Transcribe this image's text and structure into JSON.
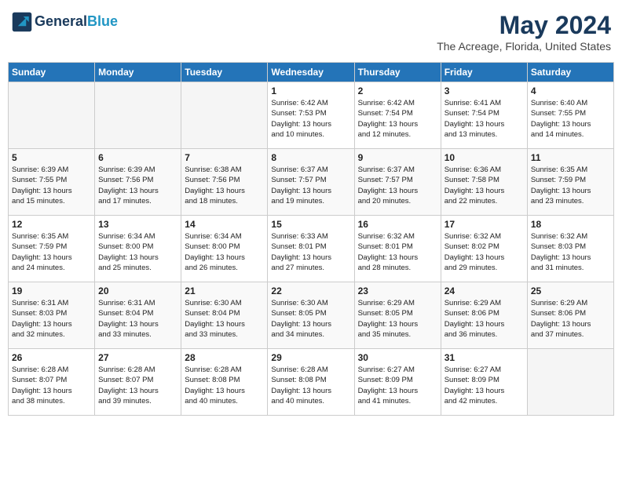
{
  "header": {
    "logo_line1": "General",
    "logo_line2": "Blue",
    "month_year": "May 2024",
    "location": "The Acreage, Florida, United States"
  },
  "weekdays": [
    "Sunday",
    "Monday",
    "Tuesday",
    "Wednesday",
    "Thursday",
    "Friday",
    "Saturday"
  ],
  "weeks": [
    [
      {
        "day": "",
        "info": ""
      },
      {
        "day": "",
        "info": ""
      },
      {
        "day": "",
        "info": ""
      },
      {
        "day": "1",
        "info": "Sunrise: 6:42 AM\nSunset: 7:53 PM\nDaylight: 13 hours\nand 10 minutes."
      },
      {
        "day": "2",
        "info": "Sunrise: 6:42 AM\nSunset: 7:54 PM\nDaylight: 13 hours\nand 12 minutes."
      },
      {
        "day": "3",
        "info": "Sunrise: 6:41 AM\nSunset: 7:54 PM\nDaylight: 13 hours\nand 13 minutes."
      },
      {
        "day": "4",
        "info": "Sunrise: 6:40 AM\nSunset: 7:55 PM\nDaylight: 13 hours\nand 14 minutes."
      }
    ],
    [
      {
        "day": "5",
        "info": "Sunrise: 6:39 AM\nSunset: 7:55 PM\nDaylight: 13 hours\nand 15 minutes."
      },
      {
        "day": "6",
        "info": "Sunrise: 6:39 AM\nSunset: 7:56 PM\nDaylight: 13 hours\nand 17 minutes."
      },
      {
        "day": "7",
        "info": "Sunrise: 6:38 AM\nSunset: 7:56 PM\nDaylight: 13 hours\nand 18 minutes."
      },
      {
        "day": "8",
        "info": "Sunrise: 6:37 AM\nSunset: 7:57 PM\nDaylight: 13 hours\nand 19 minutes."
      },
      {
        "day": "9",
        "info": "Sunrise: 6:37 AM\nSunset: 7:57 PM\nDaylight: 13 hours\nand 20 minutes."
      },
      {
        "day": "10",
        "info": "Sunrise: 6:36 AM\nSunset: 7:58 PM\nDaylight: 13 hours\nand 22 minutes."
      },
      {
        "day": "11",
        "info": "Sunrise: 6:35 AM\nSunset: 7:59 PM\nDaylight: 13 hours\nand 23 minutes."
      }
    ],
    [
      {
        "day": "12",
        "info": "Sunrise: 6:35 AM\nSunset: 7:59 PM\nDaylight: 13 hours\nand 24 minutes."
      },
      {
        "day": "13",
        "info": "Sunrise: 6:34 AM\nSunset: 8:00 PM\nDaylight: 13 hours\nand 25 minutes."
      },
      {
        "day": "14",
        "info": "Sunrise: 6:34 AM\nSunset: 8:00 PM\nDaylight: 13 hours\nand 26 minutes."
      },
      {
        "day": "15",
        "info": "Sunrise: 6:33 AM\nSunset: 8:01 PM\nDaylight: 13 hours\nand 27 minutes."
      },
      {
        "day": "16",
        "info": "Sunrise: 6:32 AM\nSunset: 8:01 PM\nDaylight: 13 hours\nand 28 minutes."
      },
      {
        "day": "17",
        "info": "Sunrise: 6:32 AM\nSunset: 8:02 PM\nDaylight: 13 hours\nand 29 minutes."
      },
      {
        "day": "18",
        "info": "Sunrise: 6:32 AM\nSunset: 8:03 PM\nDaylight: 13 hours\nand 31 minutes."
      }
    ],
    [
      {
        "day": "19",
        "info": "Sunrise: 6:31 AM\nSunset: 8:03 PM\nDaylight: 13 hours\nand 32 minutes."
      },
      {
        "day": "20",
        "info": "Sunrise: 6:31 AM\nSunset: 8:04 PM\nDaylight: 13 hours\nand 33 minutes."
      },
      {
        "day": "21",
        "info": "Sunrise: 6:30 AM\nSunset: 8:04 PM\nDaylight: 13 hours\nand 33 minutes."
      },
      {
        "day": "22",
        "info": "Sunrise: 6:30 AM\nSunset: 8:05 PM\nDaylight: 13 hours\nand 34 minutes."
      },
      {
        "day": "23",
        "info": "Sunrise: 6:29 AM\nSunset: 8:05 PM\nDaylight: 13 hours\nand 35 minutes."
      },
      {
        "day": "24",
        "info": "Sunrise: 6:29 AM\nSunset: 8:06 PM\nDaylight: 13 hours\nand 36 minutes."
      },
      {
        "day": "25",
        "info": "Sunrise: 6:29 AM\nSunset: 8:06 PM\nDaylight: 13 hours\nand 37 minutes."
      }
    ],
    [
      {
        "day": "26",
        "info": "Sunrise: 6:28 AM\nSunset: 8:07 PM\nDaylight: 13 hours\nand 38 minutes."
      },
      {
        "day": "27",
        "info": "Sunrise: 6:28 AM\nSunset: 8:07 PM\nDaylight: 13 hours\nand 39 minutes."
      },
      {
        "day": "28",
        "info": "Sunrise: 6:28 AM\nSunset: 8:08 PM\nDaylight: 13 hours\nand 40 minutes."
      },
      {
        "day": "29",
        "info": "Sunrise: 6:28 AM\nSunset: 8:08 PM\nDaylight: 13 hours\nand 40 minutes."
      },
      {
        "day": "30",
        "info": "Sunrise: 6:27 AM\nSunset: 8:09 PM\nDaylight: 13 hours\nand 41 minutes."
      },
      {
        "day": "31",
        "info": "Sunrise: 6:27 AM\nSunset: 8:09 PM\nDaylight: 13 hours\nand 42 minutes."
      },
      {
        "day": "",
        "info": ""
      }
    ]
  ]
}
